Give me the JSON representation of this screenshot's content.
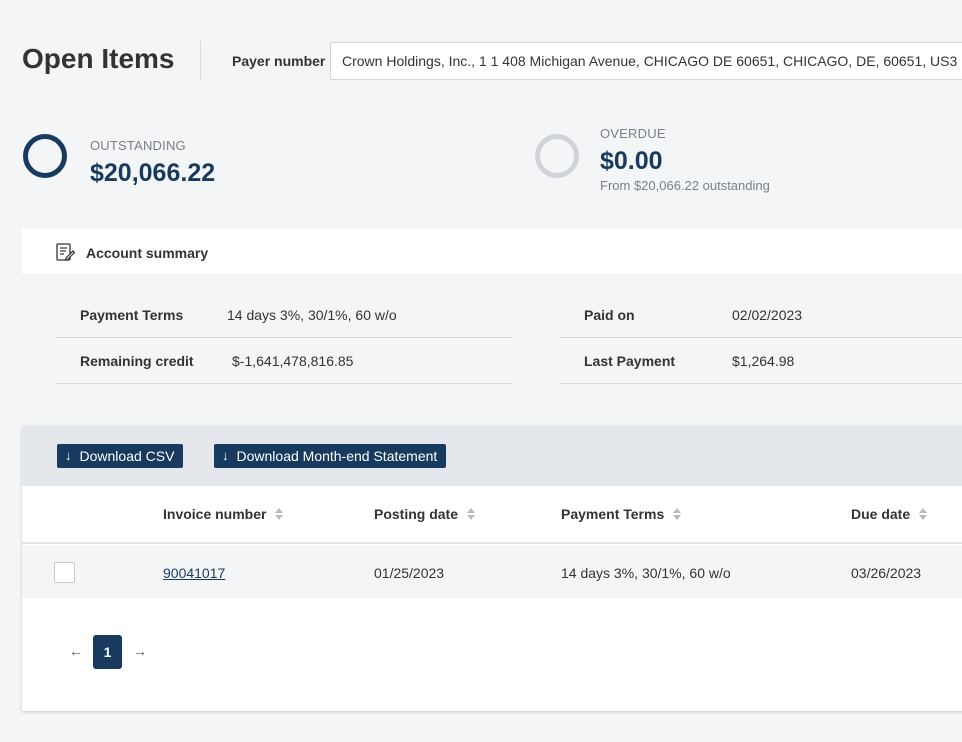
{
  "header": {
    "title": "Open Items",
    "payer_label": "Payer number",
    "payer_value": "Crown Holdings, Inc., 1 1 408 Michigan Avenue, CHICAGO DE  60651, CHICAGO, DE, 60651, US3"
  },
  "kpis": {
    "outstanding": {
      "label": "OUTSTANDING",
      "value": "$20,066.22"
    },
    "overdue": {
      "label": "OVERDUE",
      "value": "$0.00",
      "sub": "From $20,066.22 outstanding"
    }
  },
  "account_summary": {
    "title": "Account summary",
    "left": [
      {
        "label": "Payment Terms",
        "value": "14 days 3%, 30/1%, 60 w/o"
      },
      {
        "label": "Remaining credit",
        "value": "$-1,641,478,816.85"
      }
    ],
    "right": [
      {
        "label": "Paid on",
        "value": "02/02/2023"
      },
      {
        "label": "Last Payment",
        "value": "$1,264.98"
      }
    ]
  },
  "toolbar": {
    "download_csv": "Download CSV",
    "download_statement": "Download Month-end Statement"
  },
  "table": {
    "columns": [
      "Invoice number",
      "Posting date",
      "Payment Terms",
      "Due date"
    ],
    "rows": [
      {
        "invoice": "90041017",
        "posting_date": "01/25/2023",
        "payment_terms": "14 days 3%, 30/1%, 60 w/o",
        "due_date": "03/26/2023"
      }
    ]
  },
  "pagination": {
    "prev": "←",
    "current": "1",
    "next": "→"
  },
  "colors": {
    "primary": "#173a5e",
    "ring_inactive": "#d0d3d8",
    "toolbar_bg": "#e4e8ec"
  }
}
